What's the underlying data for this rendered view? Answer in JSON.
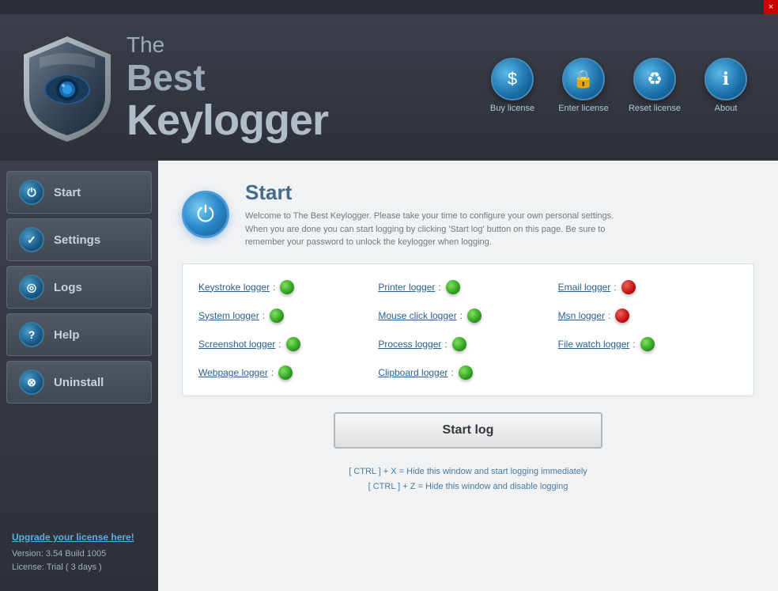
{
  "window": {
    "close_label": "×"
  },
  "header": {
    "title_line1": "The",
    "title_line2": "Best Keylogger",
    "buttons": [
      {
        "id": "buy",
        "label": "Buy license",
        "icon": "$"
      },
      {
        "id": "enter",
        "label": "Enter license",
        "icon": "🔒"
      },
      {
        "id": "reset",
        "label": "Reset license",
        "icon": "♻"
      },
      {
        "id": "about",
        "label": "About",
        "icon": "ℹ"
      }
    ]
  },
  "sidebar": {
    "items": [
      {
        "id": "start",
        "label": "Start",
        "icon": "⏻"
      },
      {
        "id": "settings",
        "label": "Settings",
        "icon": "✓"
      },
      {
        "id": "logs",
        "label": "Logs",
        "icon": "⊙"
      },
      {
        "id": "help",
        "label": "Help",
        "icon": "?"
      },
      {
        "id": "uninstall",
        "label": "Uninstall",
        "icon": "⊗"
      }
    ],
    "upgrade_label": "Upgrade your license here!",
    "version_label": "Version",
    "version_value": ": 3.54 Build 1005",
    "license_label": "License",
    "license_value": ":  Trial ( 3 days )"
  },
  "content": {
    "title": "Start",
    "description": "Welcome to The Best Keylogger. Please take your time to configure your own personal settings. When you are done you can start logging by clicking 'Start log' button on this page. Be sure to remember your password to unlock the keylogger when logging.",
    "loggers": [
      {
        "row": 0,
        "cells": [
          {
            "label": "Keystroke logger",
            "status": "green"
          },
          {
            "label": "Printer logger",
            "status": "green"
          },
          {
            "label": "Email logger",
            "status": "red"
          }
        ]
      },
      {
        "row": 1,
        "cells": [
          {
            "label": "System logger",
            "status": "green"
          },
          {
            "label": "Mouse click logger",
            "status": "green"
          },
          {
            "label": "Msn logger",
            "status": "red"
          }
        ]
      },
      {
        "row": 2,
        "cells": [
          {
            "label": "Screenshot logger",
            "status": "green"
          },
          {
            "label": "Process logger",
            "status": "green"
          },
          {
            "label": "File watch logger",
            "status": "green"
          }
        ]
      },
      {
        "row": 3,
        "cells": [
          {
            "label": "Webpage logger",
            "status": "green"
          },
          {
            "label": "Clipboard logger",
            "status": "green"
          },
          {
            "label": "",
            "status": "none"
          }
        ]
      }
    ],
    "start_log_btn": "Start log",
    "hotkey1": "[ CTRL ] + X = Hide this window and start logging immediately",
    "hotkey2": "[ CTRL ] + Z = Hide this window and disable logging"
  }
}
